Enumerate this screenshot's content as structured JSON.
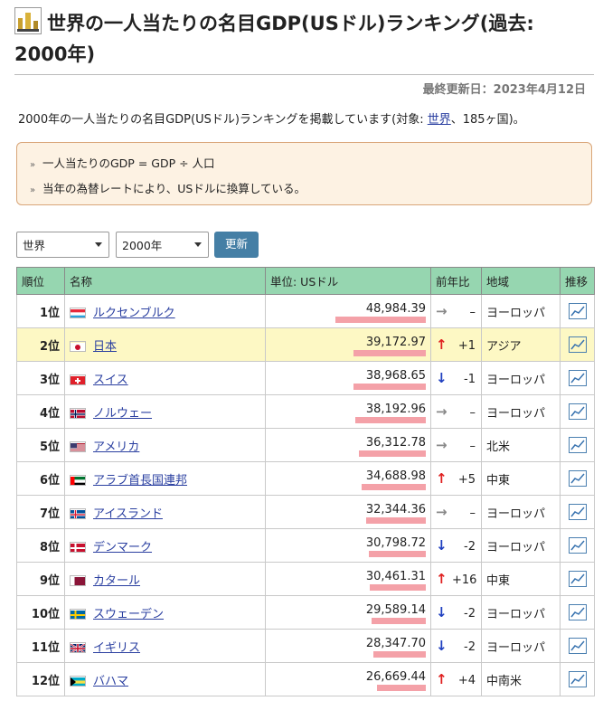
{
  "page": {
    "title": "世界の一人当たりの名目GDP(USドル)ランキング(過去: 2000年)",
    "updated": "最終更新日：2023年4月12日",
    "desc_prefix": "2000年の一人当たりの名目GDP(USドル)ランキングを掲載しています(対象: ",
    "desc_link": "世界",
    "desc_suffix": "、185ヶ国)。",
    "notes": [
      "一人当たりのGDP = GDP ÷ 人口",
      "当年の為替レートにより、USドルに換算している。"
    ]
  },
  "controls": {
    "region_select": "世界",
    "year_select": "2000年",
    "update_button": "更新"
  },
  "table": {
    "headers": {
      "rank": "順位",
      "name": "名称",
      "value": "単位: USドル",
      "change": "前年比",
      "region": "地域",
      "trend": "推移"
    },
    "rows": [
      {
        "rank": "1位",
        "name": "ルクセンブルク",
        "value": "48,984.39",
        "v": 48984.39,
        "arrow": "flat",
        "change": "–",
        "region": "ヨーロッパ",
        "flag": "lu"
      },
      {
        "rank": "2位",
        "name": "日本",
        "value": "39,172.97",
        "v": 39172.97,
        "arrow": "up",
        "change": "+1",
        "region": "アジア",
        "flag": "jp",
        "highlight": true
      },
      {
        "rank": "3位",
        "name": "スイス",
        "value": "38,968.65",
        "v": 38968.65,
        "arrow": "down",
        "change": "-1",
        "region": "ヨーロッパ",
        "flag": "ch"
      },
      {
        "rank": "4位",
        "name": "ノルウェー",
        "value": "38,192.96",
        "v": 38192.96,
        "arrow": "flat",
        "change": "–",
        "region": "ヨーロッパ",
        "flag": "no"
      },
      {
        "rank": "5位",
        "name": "アメリカ",
        "value": "36,312.78",
        "v": 36312.78,
        "arrow": "flat",
        "change": "–",
        "region": "北米",
        "flag": "us"
      },
      {
        "rank": "6位",
        "name": "アラブ首長国連邦",
        "value": "34,688.98",
        "v": 34688.98,
        "arrow": "up",
        "change": "+5",
        "region": "中東",
        "flag": "ae"
      },
      {
        "rank": "7位",
        "name": "アイスランド",
        "value": "32,344.36",
        "v": 32344.36,
        "arrow": "flat",
        "change": "–",
        "region": "ヨーロッパ",
        "flag": "is"
      },
      {
        "rank": "8位",
        "name": "デンマーク",
        "value": "30,798.72",
        "v": 30798.72,
        "arrow": "down",
        "change": "-2",
        "region": "ヨーロッパ",
        "flag": "dk"
      },
      {
        "rank": "9位",
        "name": "カタール",
        "value": "30,461.31",
        "v": 30461.31,
        "arrow": "up",
        "change": "+16",
        "region": "中東",
        "flag": "qa"
      },
      {
        "rank": "10位",
        "name": "スウェーデン",
        "value": "29,589.14",
        "v": 29589.14,
        "arrow": "down",
        "change": "-2",
        "region": "ヨーロッパ",
        "flag": "se"
      },
      {
        "rank": "11位",
        "name": "イギリス",
        "value": "28,347.70",
        "v": 28347.7,
        "arrow": "down",
        "change": "-2",
        "region": "ヨーロッパ",
        "flag": "gb"
      },
      {
        "rank": "12位",
        "name": "バハマ",
        "value": "26,669.44",
        "v": 26669.44,
        "arrow": "up",
        "change": "+4",
        "region": "中南米",
        "flag": "bs"
      }
    ]
  },
  "colors": {
    "up": "#e02020",
    "down": "#2040c0",
    "flat": "#888888",
    "bar": "#f4a1a8",
    "highlight": "#fdf8c4",
    "header": "#96d6b0"
  }
}
